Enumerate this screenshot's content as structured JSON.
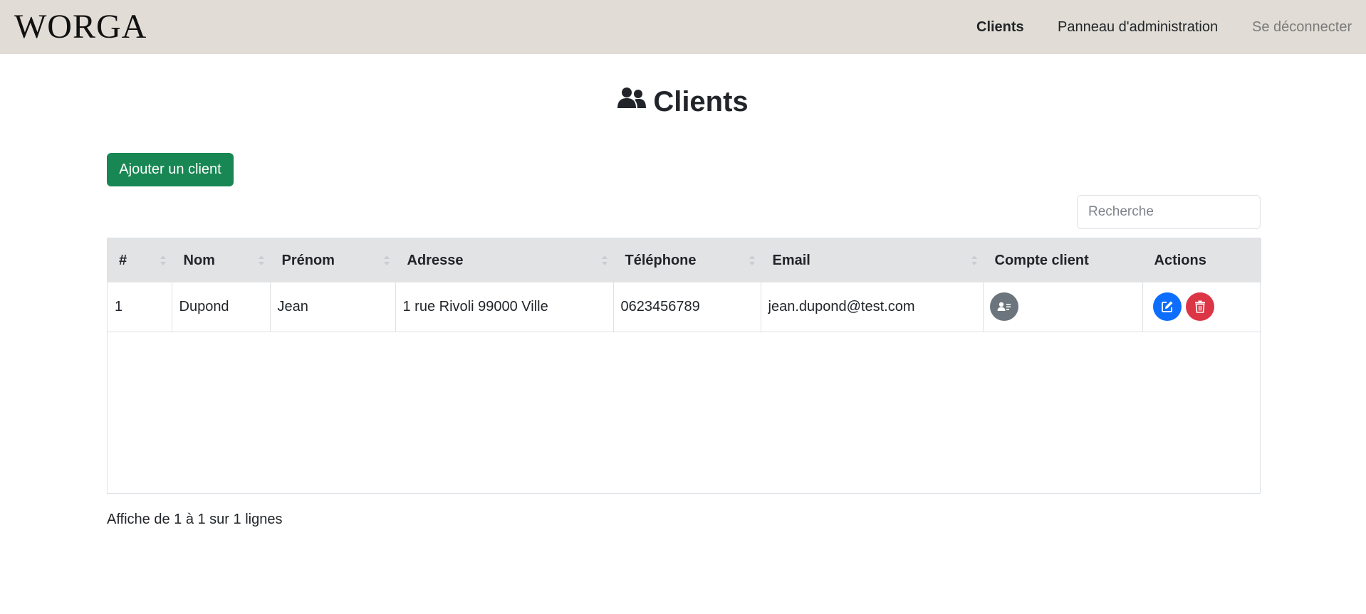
{
  "navbar": {
    "brand": "WORGA",
    "links": [
      {
        "label": "Clients",
        "active": true
      },
      {
        "label": "Panneau d'administration",
        "active": false
      },
      {
        "label": "Se déconnecter",
        "active": false
      }
    ]
  },
  "page": {
    "title": "Clients",
    "title_icon": "users-icon"
  },
  "toolbar": {
    "add_label": "Ajouter un client",
    "search_placeholder": "Recherche",
    "search_value": ""
  },
  "table": {
    "headers": [
      "#",
      "Nom",
      "Prénom",
      "Adresse",
      "Téléphone",
      "Email",
      "Compte client",
      "Actions"
    ],
    "rows": [
      {
        "id": "1",
        "nom": "Dupond",
        "prenom": "Jean",
        "adresse": "1 rue Rivoli 99000 Ville",
        "telephone": "0623456789",
        "email": "jean.dupond@test.com",
        "account_icon": "user-card-icon",
        "actions": [
          "edit-icon",
          "trash-icon"
        ]
      }
    ]
  },
  "pagination": {
    "info": "Affiche de 1 à 1 sur 1 lignes"
  },
  "colors": {
    "navbar_bg": "#e1ddd6",
    "add_button": "#198754",
    "account_button": "#6c757d",
    "edit_button": "#0d6efd",
    "delete_button": "#dc3545",
    "table_header_bg": "#e2e3e5"
  }
}
